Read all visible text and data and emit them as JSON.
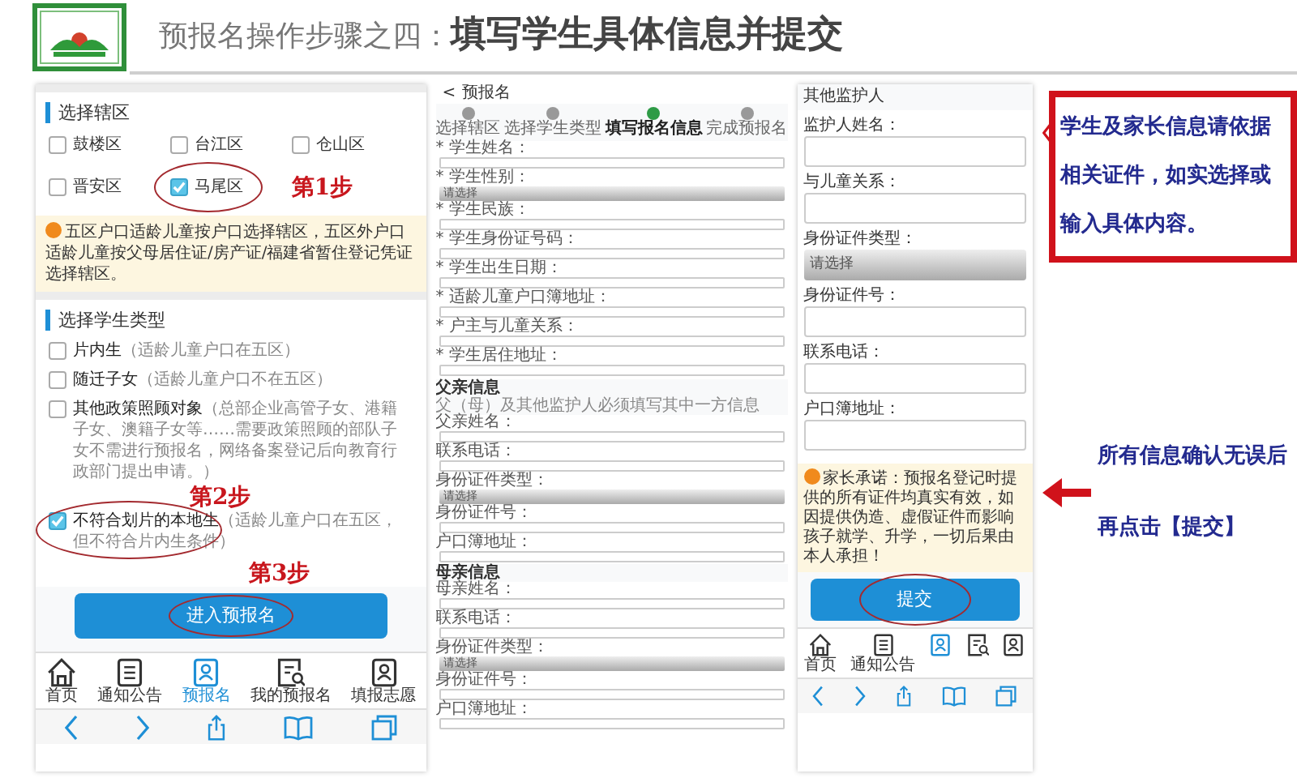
{
  "header": {
    "title": "预报名操作步骤之四：**填写学生具体信息并提交**"
  },
  "screen_1": {
    "district_section": {
      "title": "选择辖区",
      "step_mark": "第1步",
      "options": [
        {
          "label": "鼓楼区",
          "checked": false,
          "circled": false
        },
        {
          "label": "台江区",
          "checked": false,
          "circled": false
        },
        {
          "label": "仓山区",
          "checked": false,
          "circled": false
        },
        {
          "label": "晋安区",
          "checked": false,
          "circled": false
        },
        {
          "label": "马尾区",
          "checked": true,
          "circled": true
        }
      ],
      "notice": "五区户口适龄儿童按户口选择辖区，五区外户口适龄儿童按父母居住证/房产证/福建省暂住登记凭证选择辖区。"
    },
    "type_section": {
      "title": "选择学生类型",
      "step_mark": "第2步",
      "options": [
        {
          "label": "片内生",
          "note": "（适龄儿童户口在五区）",
          "checked": false,
          "circled": false
        },
        {
          "label": "随迁子女",
          "note": "（适龄儿童户口不在五区）",
          "checked": false,
          "circled": false
        },
        {
          "label": "其他政策照顾对象",
          "note": "（总部企业高管子女、港籍子女、澳籍子女等……需要政策照顾的部队子女不需进行预报名，网络备案登记后向教育行政部门提出申请。）",
          "checked": false,
          "circled": false
        },
        {
          "label": "不符合划片的本地生",
          "note": "（适龄儿童户口在五区，但不符合片内生条件）",
          "checked": true,
          "circled": true
        }
      ]
    },
    "submit_button": {
      "label": "进入预报名",
      "step_mark": "第3步",
      "circled": true
    },
    "tab_bar": [
      {
        "label": "首页",
        "selected": false
      },
      {
        "label": "通知公告",
        "selected": false
      },
      {
        "label": "预报名",
        "selected": true
      },
      {
        "label": "我的预报名",
        "selected": false
      },
      {
        "label": "填报志愿",
        "selected": false
      }
    ]
  },
  "screen_2": {
    "back": "<",
    "title": "预报名",
    "steps": [
      {
        "label": "选择辖区",
        "selected": false
      },
      {
        "label": "选择学生类型",
        "selected": false
      },
      {
        "label": "填写报名信息",
        "selected": true
      },
      {
        "label": "完成预报名",
        "selected": false
      }
    ],
    "student_fields": [
      {
        "label": "* 学生姓名：",
        "kind": "input"
      },
      {
        "label": "* 学生性别：",
        "kind": "select",
        "placeholder": "请选择"
      },
      {
        "label": "* 学生民族：",
        "kind": "input"
      },
      {
        "label": "* 学生身份证号码：",
        "kind": "input"
      },
      {
        "label": "* 学生出生日期：",
        "kind": "input"
      },
      {
        "label": "* 适龄儿童户口簿地址：",
        "kind": "input"
      },
      {
        "label": "* 户主与儿童关系：",
        "kind": "input"
      },
      {
        "label": "* 学生居住地址：",
        "kind": "input"
      }
    ],
    "father": {
      "title": "父亲信息",
      "note": "父（母）及其他监护人必须填写其中一方信息",
      "fields": [
        {
          "label": "父亲姓名：",
          "kind": "input"
        },
        {
          "label": "联系电话：",
          "kind": "input"
        },
        {
          "label": "身份证件类型：",
          "kind": "select",
          "placeholder": "请选择"
        },
        {
          "label": "身份证件号：",
          "kind": "input"
        },
        {
          "label": "户口簿地址：",
          "kind": "input"
        }
      ]
    },
    "mother": {
      "title": "母亲信息",
      "fields": [
        {
          "label": "母亲姓名：",
          "kind": "input"
        },
        {
          "label": "联系电话：",
          "kind": "input"
        },
        {
          "label": "身份证件类型：",
          "kind": "select",
          "placeholder": "请选择"
        },
        {
          "label": "身份证件号：",
          "kind": "input"
        },
        {
          "label": "户口簿地址：",
          "kind": "input"
        }
      ]
    }
  },
  "screen_3": {
    "section_title": "其他监护人",
    "fields": [
      {
        "label": "监护人姓名：",
        "kind": "input"
      },
      {
        "label": "与儿童关系：",
        "kind": "input"
      },
      {
        "label": "身份证件类型：",
        "kind": "select",
        "placeholder": "请选择"
      },
      {
        "label": "身份证件号：",
        "kind": "input"
      },
      {
        "label": "联系电话：",
        "kind": "input"
      },
      {
        "label": "户口簿地址：",
        "kind": "input"
      }
    ],
    "notice": "家长承诺：预报名登记时提供的所有证件均真实有效，如因提供伪造、虚假证件而影响孩子就学、升学，一切后果由本人承担！",
    "submit_button": {
      "label": "提交",
      "circled": true
    },
    "tab_bar": [
      {
        "label": "首页",
        "selected": false
      },
      {
        "label": "通知公告",
        "selected": false
      },
      {
        "selected": true
      },
      {
        "selected": false
      },
      {
        "selected": false
      }
    ]
  },
  "callout": {
    "text": "学生及家长信息请依据相关证件，如实选择或输入具体内容。"
  },
  "final_note": {
    "lines": [
      "所有信息确认无误后",
      "再点击【提交】"
    ]
  }
}
